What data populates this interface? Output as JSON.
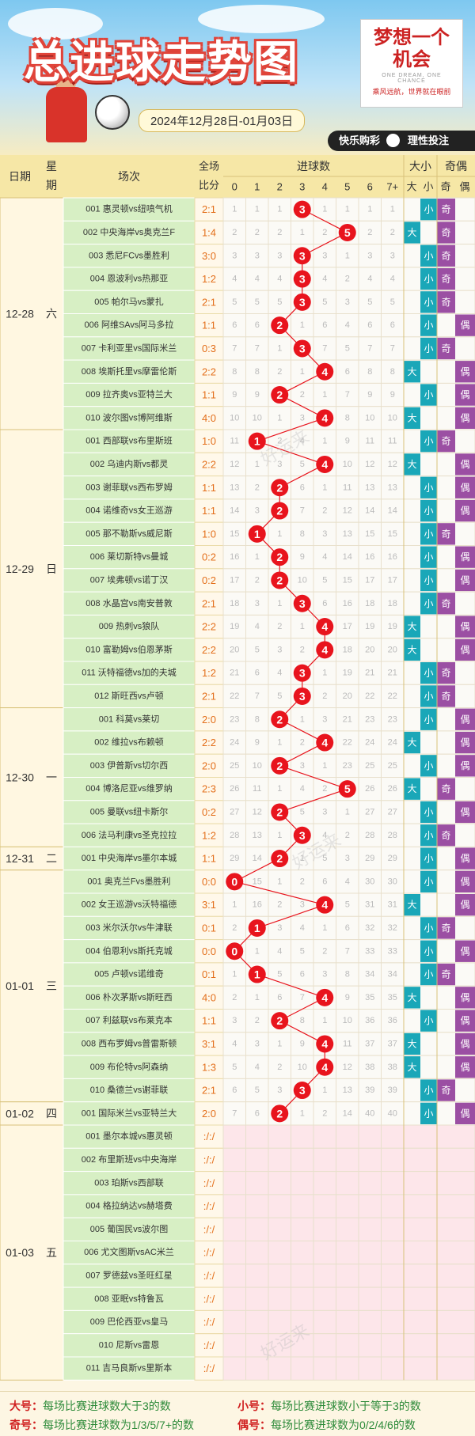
{
  "header": {
    "title": "总进球走势图",
    "date_range": "2024年12月28日-01月03日",
    "logo": {
      "main": "梦想一个机会",
      "english": "ONE DREAM, ONE CHANCE",
      "tagline": "乘风远航，世界就在眼前"
    },
    "brands": [
      "快乐购彩",
      "理性投注"
    ]
  },
  "table_headers": {
    "date": "日期",
    "weekday": "星期",
    "match": "场次",
    "score": "全场比分",
    "goals": "进球数",
    "big_small": "大小",
    "odd_even": "奇偶",
    "goal_cols": [
      "0",
      "1",
      "2",
      "3",
      "4",
      "5",
      "6",
      "7+"
    ],
    "big": "大",
    "small": "小",
    "odd": "奇",
    "even": "偶"
  },
  "chart_data": {
    "type": "table",
    "groups": [
      {
        "date": "12-28",
        "weekday": "六",
        "matches": [
          {
            "name": "001 惠灵顿vs纽喷气机",
            "score": "2:1",
            "goals": 3,
            "miss": [
              1,
              1,
              1,
              null,
              1,
              1,
              1,
              1
            ],
            "size": "小",
            "parity": "奇"
          },
          {
            "name": "002 中央海岸vs奥克兰F",
            "score": "1:4",
            "goals": 5,
            "miss": [
              2,
              2,
              2,
              1,
              2,
              null,
              2,
              2
            ],
            "size": "大",
            "parity": "奇"
          },
          {
            "name": "003 悉尼FCvs墨胜利",
            "score": "3:0",
            "goals": 3,
            "miss": [
              3,
              3,
              3,
              null,
              3,
              1,
              3,
              3
            ],
            "size": "小",
            "parity": "奇"
          },
          {
            "name": "004 恩波利vs热那亚",
            "score": "1:2",
            "goals": 3,
            "miss": [
              4,
              4,
              4,
              null,
              4,
              2,
              4,
              4
            ],
            "size": "小",
            "parity": "奇"
          },
          {
            "name": "005 帕尔马vs蒙扎",
            "score": "2:1",
            "goals": 3,
            "miss": [
              5,
              5,
              5,
              null,
              5,
              3,
              5,
              5
            ],
            "size": "小",
            "parity": "奇"
          },
          {
            "name": "006 阿维SAvs阿马多拉",
            "score": "1:1",
            "goals": 2,
            "miss": [
              6,
              6,
              null,
              1,
              6,
              4,
              6,
              6
            ],
            "size": "小",
            "parity": "偶"
          },
          {
            "name": "007 卡利亚里vs国际米兰",
            "score": "0:3",
            "goals": 3,
            "miss": [
              7,
              7,
              1,
              null,
              7,
              5,
              7,
              7
            ],
            "size": "小",
            "parity": "奇"
          },
          {
            "name": "008 埃斯托里vs摩雷伦斯",
            "score": "2:2",
            "goals": 4,
            "miss": [
              8,
              8,
              2,
              1,
              null,
              6,
              8,
              8
            ],
            "size": "大",
            "parity": "偶"
          },
          {
            "name": "009 拉齐奥vs亚特兰大",
            "score": "1:1",
            "goals": 2,
            "miss": [
              9,
              9,
              null,
              2,
              1,
              7,
              9,
              9
            ],
            "size": "小",
            "parity": "偶"
          },
          {
            "name": "010 波尔图vs博阿维斯",
            "score": "4:0",
            "goals": 4,
            "miss": [
              10,
              10,
              1,
              3,
              null,
              8,
              10,
              10
            ],
            "size": "大",
            "parity": "偶"
          }
        ]
      },
      {
        "date": "12-29",
        "weekday": "日",
        "matches": [
          {
            "name": "001 西部联vs布里斯班",
            "score": "1:0",
            "goals": 1,
            "miss": [
              11,
              null,
              2,
              4,
              1,
              9,
              11,
              11
            ],
            "size": "小",
            "parity": "奇"
          },
          {
            "name": "002 乌迪内斯vs都灵",
            "score": "2:2",
            "goals": 4,
            "miss": [
              12,
              1,
              3,
              5,
              null,
              10,
              12,
              12
            ],
            "size": "大",
            "parity": "偶"
          },
          {
            "name": "003 谢菲联vs西布罗姆",
            "score": "1:1",
            "goals": 2,
            "miss": [
              13,
              2,
              null,
              6,
              1,
              11,
              13,
              13
            ],
            "size": "小",
            "parity": "偶"
          },
          {
            "name": "004 诺维奇vs女王巡游",
            "score": "1:1",
            "goals": 2,
            "miss": [
              14,
              3,
              null,
              7,
              2,
              12,
              14,
              14
            ],
            "size": "小",
            "parity": "偶"
          },
          {
            "name": "005 那不勒斯vs威尼斯",
            "score": "1:0",
            "goals": 1,
            "miss": [
              15,
              null,
              1,
              8,
              3,
              13,
              15,
              15
            ],
            "size": "小",
            "parity": "奇"
          },
          {
            "name": "006 莱切斯特vs曼城",
            "score": "0:2",
            "goals": 2,
            "miss": [
              16,
              1,
              null,
              9,
              4,
              14,
              16,
              16
            ],
            "size": "小",
            "parity": "偶"
          },
          {
            "name": "007 埃弗顿vs诺丁汉",
            "score": "0:2",
            "goals": 2,
            "miss": [
              17,
              2,
              null,
              10,
              5,
              15,
              17,
              17
            ],
            "size": "小",
            "parity": "偶"
          },
          {
            "name": "008 水晶宫vs南安普敦",
            "score": "2:1",
            "goals": 3,
            "miss": [
              18,
              3,
              1,
              null,
              6,
              16,
              18,
              18
            ],
            "size": "小",
            "parity": "奇"
          },
          {
            "name": "009 热刺vs狼队",
            "score": "2:2",
            "goals": 4,
            "miss": [
              19,
              4,
              2,
              1,
              null,
              17,
              19,
              19
            ],
            "size": "大",
            "parity": "偶"
          },
          {
            "name": "010 富勒姆vs伯恩茅斯",
            "score": "2:2",
            "goals": 4,
            "miss": [
              20,
              5,
              3,
              2,
              null,
              18,
              20,
              20
            ],
            "size": "大",
            "parity": "偶"
          },
          {
            "name": "011 沃特福德vs加的夫城",
            "score": "1:2",
            "goals": 3,
            "miss": [
              21,
              6,
              4,
              null,
              1,
              19,
              21,
              21
            ],
            "size": "小",
            "parity": "奇"
          },
          {
            "name": "012 斯旺西vs卢顿",
            "score": "2:1",
            "goals": 3,
            "miss": [
              22,
              7,
              5,
              null,
              2,
              20,
              22,
              22
            ],
            "size": "小",
            "parity": "奇"
          }
        ]
      },
      {
        "date": "12-30",
        "weekday": "一",
        "matches": [
          {
            "name": "001 科莫vs莱切",
            "score": "2:0",
            "goals": 2,
            "miss": [
              23,
              8,
              null,
              1,
              3,
              21,
              23,
              23
            ],
            "size": "小",
            "parity": "偶"
          },
          {
            "name": "002 维拉vs布赖顿",
            "score": "2:2",
            "goals": 4,
            "miss": [
              24,
              9,
              1,
              2,
              null,
              22,
              24,
              24
            ],
            "size": "大",
            "parity": "偶"
          },
          {
            "name": "003 伊普斯vs切尔西",
            "score": "2:0",
            "goals": 2,
            "miss": [
              25,
              10,
              null,
              3,
              1,
              23,
              25,
              25
            ],
            "size": "小",
            "parity": "偶"
          },
          {
            "name": "004 博洛尼亚vs维罗纳",
            "score": "2:3",
            "goals": 5,
            "miss": [
              26,
              11,
              1,
              4,
              2,
              null,
              26,
              26
            ],
            "size": "大",
            "parity": "奇"
          },
          {
            "name": "005 曼联vs纽卡斯尔",
            "score": "0:2",
            "goals": 2,
            "miss": [
              27,
              12,
              null,
              5,
              3,
              1,
              27,
              27
            ],
            "size": "小",
            "parity": "偶"
          },
          {
            "name": "006 法马利康vs圣克拉拉",
            "score": "1:2",
            "goals": 3,
            "miss": [
              28,
              13,
              1,
              null,
              4,
              2,
              28,
              28
            ],
            "size": "小",
            "parity": "奇"
          }
        ]
      },
      {
        "date": "12-31",
        "weekday": "二",
        "matches": [
          {
            "name": "001 中央海岸vs墨尔本城",
            "score": "1:1",
            "goals": 2,
            "miss": [
              29,
              14,
              null,
              1,
              5,
              3,
              29,
              29
            ],
            "size": "小",
            "parity": "偶"
          }
        ]
      },
      {
        "date": "01-01",
        "weekday": "三",
        "matches": [
          {
            "name": "001 奥克兰Fvs墨胜利",
            "score": "0:0",
            "goals": 0,
            "miss": [
              null,
              15,
              1,
              2,
              6,
              4,
              30,
              30
            ],
            "size": "小",
            "parity": "偶"
          },
          {
            "name": "002 女王巡游vs沃特福德",
            "score": "3:1",
            "goals": 4,
            "miss": [
              1,
              16,
              2,
              3,
              null,
              5,
              31,
              31
            ],
            "size": "大",
            "parity": "偶"
          },
          {
            "name": "003 米尔沃尔vs牛津联",
            "score": "0:1",
            "goals": 1,
            "miss": [
              2,
              null,
              3,
              4,
              1,
              6,
              32,
              32
            ],
            "size": "小",
            "parity": "奇"
          },
          {
            "name": "004 伯恩利vs斯托克城",
            "score": "0:0",
            "goals": 0,
            "miss": [
              null,
              1,
              4,
              5,
              2,
              7,
              33,
              33
            ],
            "size": "小",
            "parity": "偶"
          },
          {
            "name": "005 卢顿vs诺维奇",
            "score": "0:1",
            "goals": 1,
            "miss": [
              1,
              null,
              5,
              6,
              3,
              8,
              34,
              34
            ],
            "size": "小",
            "parity": "奇"
          },
          {
            "name": "006 朴次茅斯vs斯旺西",
            "score": "4:0",
            "goals": 4,
            "miss": [
              2,
              1,
              6,
              7,
              null,
              9,
              35,
              35
            ],
            "size": "大",
            "parity": "偶"
          },
          {
            "name": "007 利兹联vs布莱克本",
            "score": "1:1",
            "goals": 2,
            "miss": [
              3,
              2,
              null,
              8,
              1,
              10,
              36,
              36
            ],
            "size": "小",
            "parity": "偶"
          },
          {
            "name": "008 西布罗姆vs普雷斯顿",
            "score": "3:1",
            "goals": 4,
            "miss": [
              4,
              3,
              1,
              9,
              null,
              11,
              37,
              37
            ],
            "size": "大",
            "parity": "偶"
          },
          {
            "name": "009 布伦特vs阿森纳",
            "score": "1:3",
            "goals": 4,
            "miss": [
              5,
              4,
              2,
              10,
              null,
              12,
              38,
              38
            ],
            "size": "大",
            "parity": "偶"
          },
          {
            "name": "010 桑德兰vs谢菲联",
            "score": "2:1",
            "goals": 3,
            "miss": [
              6,
              5,
              3,
              null,
              1,
              13,
              39,
              39
            ],
            "size": "小",
            "parity": "奇"
          }
        ]
      },
      {
        "date": "01-02",
        "weekday": "四",
        "matches": [
          {
            "name": "001 国际米兰vs亚特兰大",
            "score": "2:0",
            "goals": 2,
            "miss": [
              7,
              6,
              null,
              1,
              2,
              14,
              40,
              40
            ],
            "size": "小",
            "parity": "偶"
          }
        ]
      },
      {
        "date": "01-03",
        "weekday": "五",
        "matches": [
          {
            "name": "001 墨尔本城vs惠灵顿",
            "score": ":/:/",
            "goals": null,
            "miss": null,
            "size": null,
            "parity": null
          },
          {
            "name": "002 布里斯班vs中央海岸",
            "score": ":/:/",
            "goals": null,
            "miss": null,
            "size": null,
            "parity": null
          },
          {
            "name": "003 珀斯vs西部联",
            "score": ":/:/",
            "goals": null,
            "miss": null,
            "size": null,
            "parity": null
          },
          {
            "name": "004 格拉纳达vs赫塔费",
            "score": ":/:/",
            "goals": null,
            "miss": null,
            "size": null,
            "parity": null
          },
          {
            "name": "005 葡国民vs波尔图",
            "score": ":/:/",
            "goals": null,
            "miss": null,
            "size": null,
            "parity": null
          },
          {
            "name": "006 尤文图斯vsAC米兰",
            "score": ":/:/",
            "goals": null,
            "miss": null,
            "size": null,
            "parity": null
          },
          {
            "name": "007 罗德兹vs圣旺红星",
            "score": ":/:/",
            "goals": null,
            "miss": null,
            "size": null,
            "parity": null
          },
          {
            "name": "008 亚眠vs特鲁瓦",
            "score": ":/:/",
            "goals": null,
            "miss": null,
            "size": null,
            "parity": null
          },
          {
            "name": "009 巴伦西亚vs皇马",
            "score": ":/:/",
            "goals": null,
            "miss": null,
            "size": null,
            "parity": null
          },
          {
            "name": "010 尼斯vs雷恩",
            "score": ":/:/",
            "goals": null,
            "miss": null,
            "size": null,
            "parity": null
          },
          {
            "name": "011 吉马良斯vs里斯本",
            "score": ":/:/",
            "goals": null,
            "miss": null,
            "size": null,
            "parity": null
          }
        ]
      }
    ]
  },
  "legend": {
    "big_label": "大号：",
    "big_text": "每场比赛进球数大于3的数",
    "small_label": "小号：",
    "small_text": "每场比赛进球数小于等于3的数",
    "odd_label": "奇号：",
    "odd_text": "每场比赛进球数为1/3/5/7+的数",
    "even_label": "偶号：",
    "even_text": "每场比赛进球数为0/2/4/6的数"
  },
  "watermark": "好运来",
  "colors": {
    "ball": "#e8141d",
    "line": "#e8141d",
    "big_cell": "#1aa7b8",
    "small_cell": "#1aa7b8",
    "odd_cell": "#9b4fa3",
    "even_cell": "#9b4fa3",
    "header_bg": "#f6e7a6",
    "match_bg": "#d7efc4"
  }
}
